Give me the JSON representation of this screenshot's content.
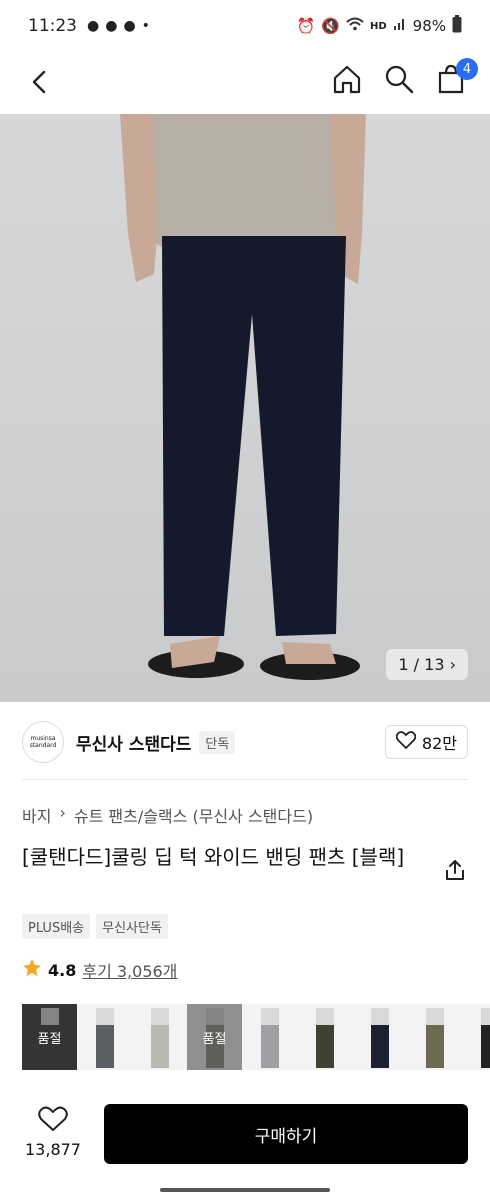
{
  "status_bar": {
    "time": "11:23",
    "battery": "98%",
    "hd_label": "HD"
  },
  "nav": {
    "cart_count": "4"
  },
  "gallery": {
    "counter": "1 / 13 ›"
  },
  "brand": {
    "logo_line1": "musinsa",
    "logo_line2": "standard",
    "name": "무신사 스탠다드",
    "tag": "단독",
    "likes": "82만"
  },
  "breadcrumb": {
    "category": "바지",
    "sep": "›",
    "subcategory": "슈트 팬츠/슬랙스 (무신사 스탠다드)"
  },
  "product": {
    "title": "[쿨탠다드]쿨링 딥 턱 와이드 밴딩 팬츠 [블랙]"
  },
  "tags": [
    "PLUS배송",
    "무신사단독"
  ],
  "rating": {
    "score": "4.8",
    "review_text": "후기 3,056개"
  },
  "thumbnails": [
    {
      "sold_label": "품절",
      "color": "#2b2b2b"
    },
    {
      "sold_label": "",
      "color": "#5b5e63"
    },
    {
      "sold_label": "",
      "color": "#b8bab2"
    },
    {
      "sold_label": "품절",
      "color": "#8e8a80"
    },
    {
      "sold_label": "",
      "color": "#9ea0a3"
    },
    {
      "sold_label": "",
      "color": "#3f4232"
    },
    {
      "sold_label": "",
      "color": "#1d2233"
    },
    {
      "sold_label": "",
      "color": "#6d6a52"
    },
    {
      "sold_label": "",
      "color": "#222222"
    }
  ],
  "bottom_bar": {
    "wish_count": "13,877",
    "buy_label": "구매하기"
  },
  "colors": {
    "accent": "#2a6df4",
    "star": "#f5a623",
    "buy_bg": "#000000"
  }
}
